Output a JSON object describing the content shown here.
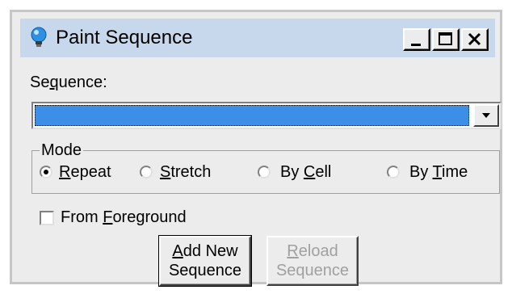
{
  "window": {
    "title": "Paint Sequence",
    "icon": "lightbulb-icon",
    "controls": {
      "minimize": "minimize-icon",
      "maximize": "maximize-icon",
      "close": "close-icon"
    }
  },
  "sequence": {
    "label": "Sequence:",
    "selected_value": ""
  },
  "mode": {
    "label": "Mode",
    "options": [
      {
        "label": "Repeat",
        "selected": true
      },
      {
        "label": "Stretch",
        "selected": false
      },
      {
        "label": "By Cell",
        "selected": false
      },
      {
        "label": "By Time",
        "selected": false
      }
    ]
  },
  "from_foreground": {
    "label": "From Foreground",
    "checked": false
  },
  "buttons": {
    "add_new_line1": "Add New",
    "add_new_line2": "Sequence",
    "reload_line1": "Reload",
    "reload_line2": "Sequence"
  },
  "colors": {
    "title_bar": "#c7d8ec",
    "selection": "#3d8ee6",
    "face": "#ececec"
  }
}
